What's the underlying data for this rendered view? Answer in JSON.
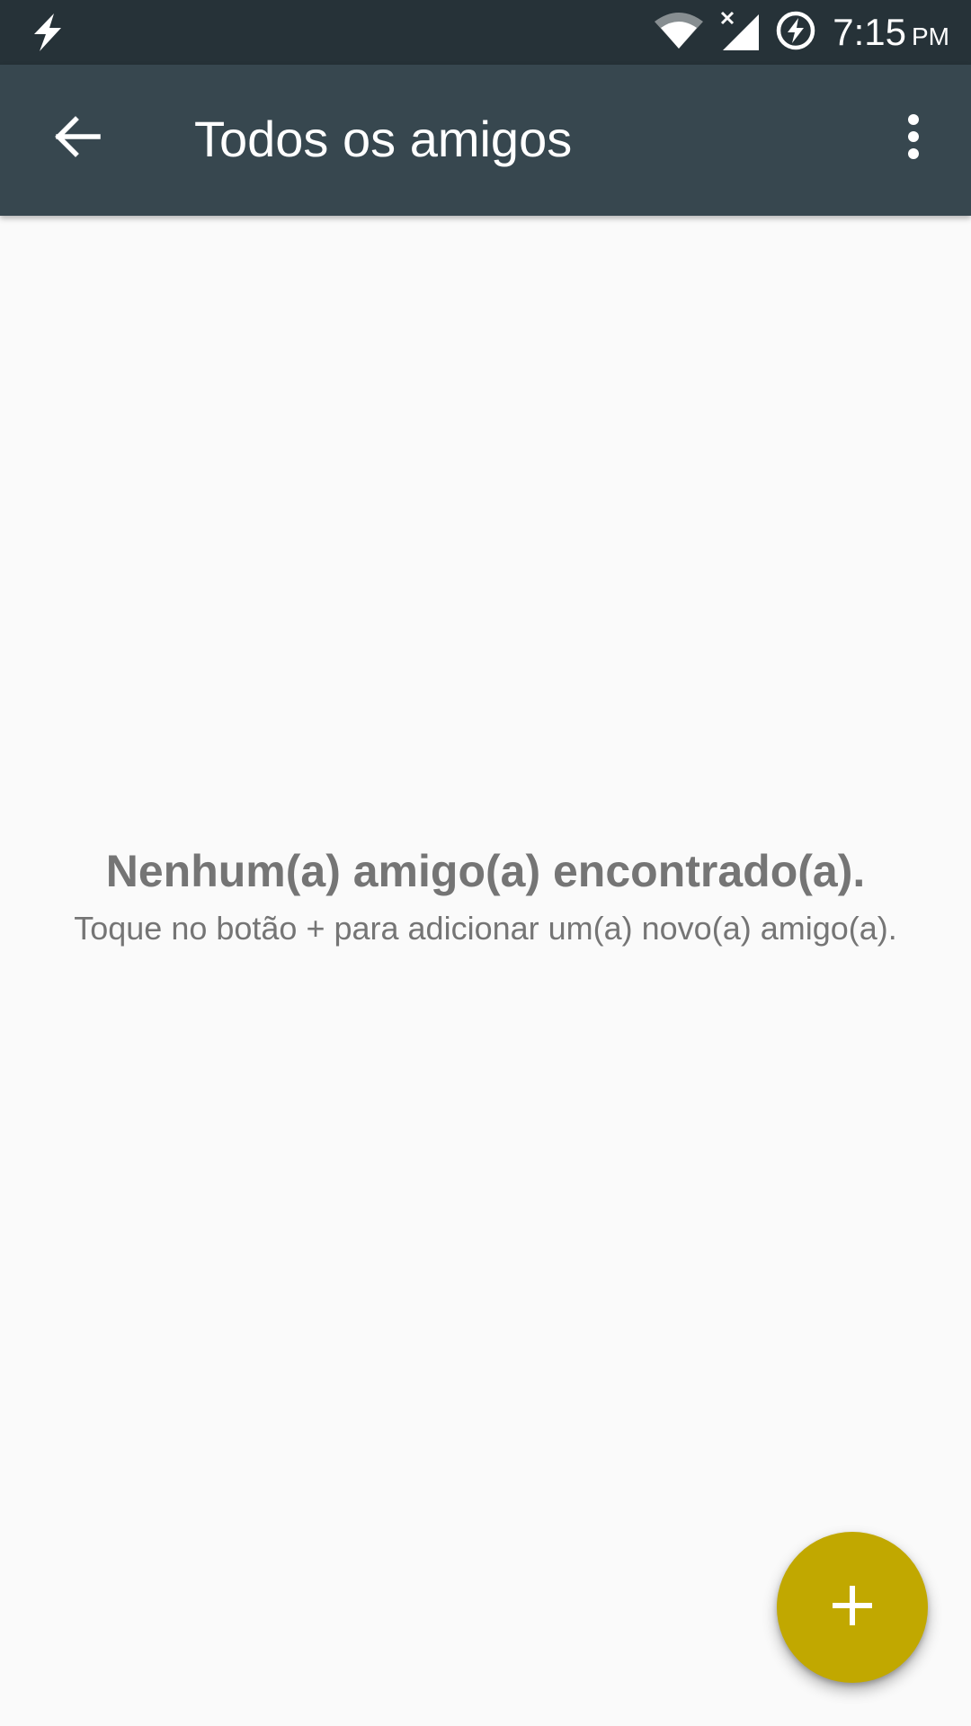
{
  "status_bar": {
    "time": "7:15",
    "ampm": "PM",
    "icons": [
      "flash-notification-icon",
      "wifi-icon",
      "no-signal-icon",
      "battery-charging-icon"
    ]
  },
  "app_bar": {
    "title": "Todos os amigos",
    "back_icon": "arrow-back-icon",
    "menu_icon": "more-vert-icon"
  },
  "empty_state": {
    "title": "Nenhum(a) amigo(a) encontrado(a).",
    "subtitle": "Toque no botão + para adicionar um(a) novo(a) amigo(a)."
  },
  "fab": {
    "icon": "plus-icon"
  },
  "colors": {
    "status_bar": "#263238",
    "app_bar": "#37474f",
    "background": "#fafafa",
    "fab": "#c1a800",
    "empty_text": "#757575"
  }
}
